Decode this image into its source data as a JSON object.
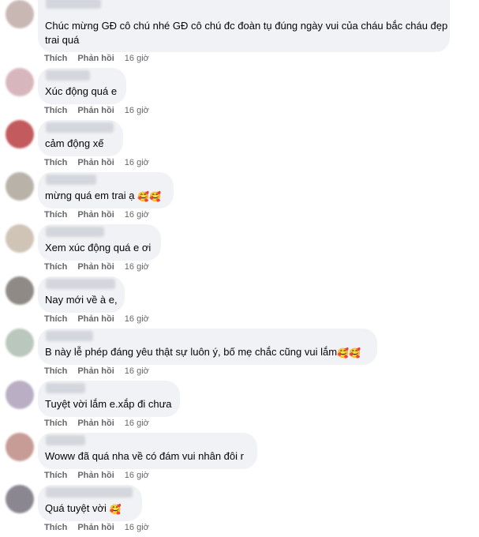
{
  "actions": {
    "like_label": "Thích",
    "reply_label": "Phản hồi"
  },
  "comments": [
    {
      "text": "Chúc mừng GĐ cô chú nhé GĐ cô chú đc đoàn tụ đúng ngày vui của cháu bắc cháu đẹp trai quá",
      "time": "16 giờ",
      "emojis": "",
      "avatar_color": "#c9b7b3"
    },
    {
      "text": "Xúc động quá e",
      "time": "16 giờ",
      "emojis": "",
      "avatar_color": "#d8b6bd"
    },
    {
      "text": "cảm động xế",
      "time": "16 giờ",
      "emojis": "",
      "avatar_color": "#c25a5e"
    },
    {
      "text": "mừng quá em trai ạ",
      "time": "16 giờ",
      "emojis": "🥰🥰",
      "avatar_color": "#b8b2a8"
    },
    {
      "text": "Xem xúc động quá e ơi",
      "time": "16 giờ",
      "emojis": "",
      "avatar_color": "#cfc4b6"
    },
    {
      "text": "Nay mới về à e,",
      "time": "16 giờ",
      "emojis": "",
      "avatar_color": "#8f8a85"
    },
    {
      "text": "B này lễ phép đáng yêu thật sự luôn ý, bố mẹ chắc cũng vui lắm",
      "time": "16 giờ",
      "emojis": "🥰🥰",
      "avatar_color": "#b9c7bd"
    },
    {
      "text": "Tuyệt vời lắm e.xắp đi chưa",
      "time": "16 giờ",
      "emojis": "",
      "avatar_color": "#b9aec3"
    },
    {
      "text": "Woww đã quá nha về có đám vui nhân đôi r",
      "time": "16 giờ",
      "emojis": "",
      "avatar_color": "#c79b96"
    },
    {
      "text": "Quá tuyệt vời",
      "time": "16 giờ",
      "emojis": "🥰",
      "avatar_color": "#8a8790"
    }
  ]
}
